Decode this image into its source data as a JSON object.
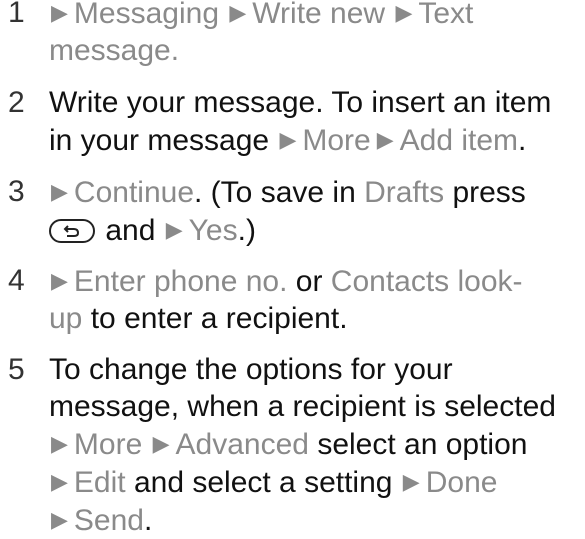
{
  "steps": [
    {
      "number": "1",
      "lines": [
        {
          "text": "Messaging",
          "arrow2": "Write new",
          "arrow3": "Text"
        },
        {
          "text": "message."
        }
      ]
    },
    {
      "number": "2",
      "line1": "Write your message. To insert an item",
      "line2_prefix": "in your message",
      "line2_more": "More",
      "line2_add": "Add item",
      "line2_end": "."
    },
    {
      "number": "3",
      "continue": "Continue",
      "paren_open": ". (To save in ",
      "drafts": "Drafts",
      "press": " press",
      "and": " and ",
      "yes": "Yes",
      "close": ".)"
    },
    {
      "number": "4",
      "enter": "Enter phone no.",
      "or": " or ",
      "contacts": "Contacts look-",
      "up": "up",
      "rest": " to enter a recipient."
    },
    {
      "number": "5",
      "line1": "To change the options for your",
      "line2": "message, when a recipient is selected",
      "more": "More",
      "advanced": "Advanced",
      "select_option": " select an option",
      "edit": "Edit",
      "select_setting": " and select a setting ",
      "done": "Done",
      "send": "Send",
      "send_end": "."
    }
  ],
  "icons": {
    "arrow": "right-triangle-icon",
    "back_key": "back-key-icon"
  },
  "colors": {
    "text": "#111111",
    "highlight": "#8a8a8a"
  }
}
